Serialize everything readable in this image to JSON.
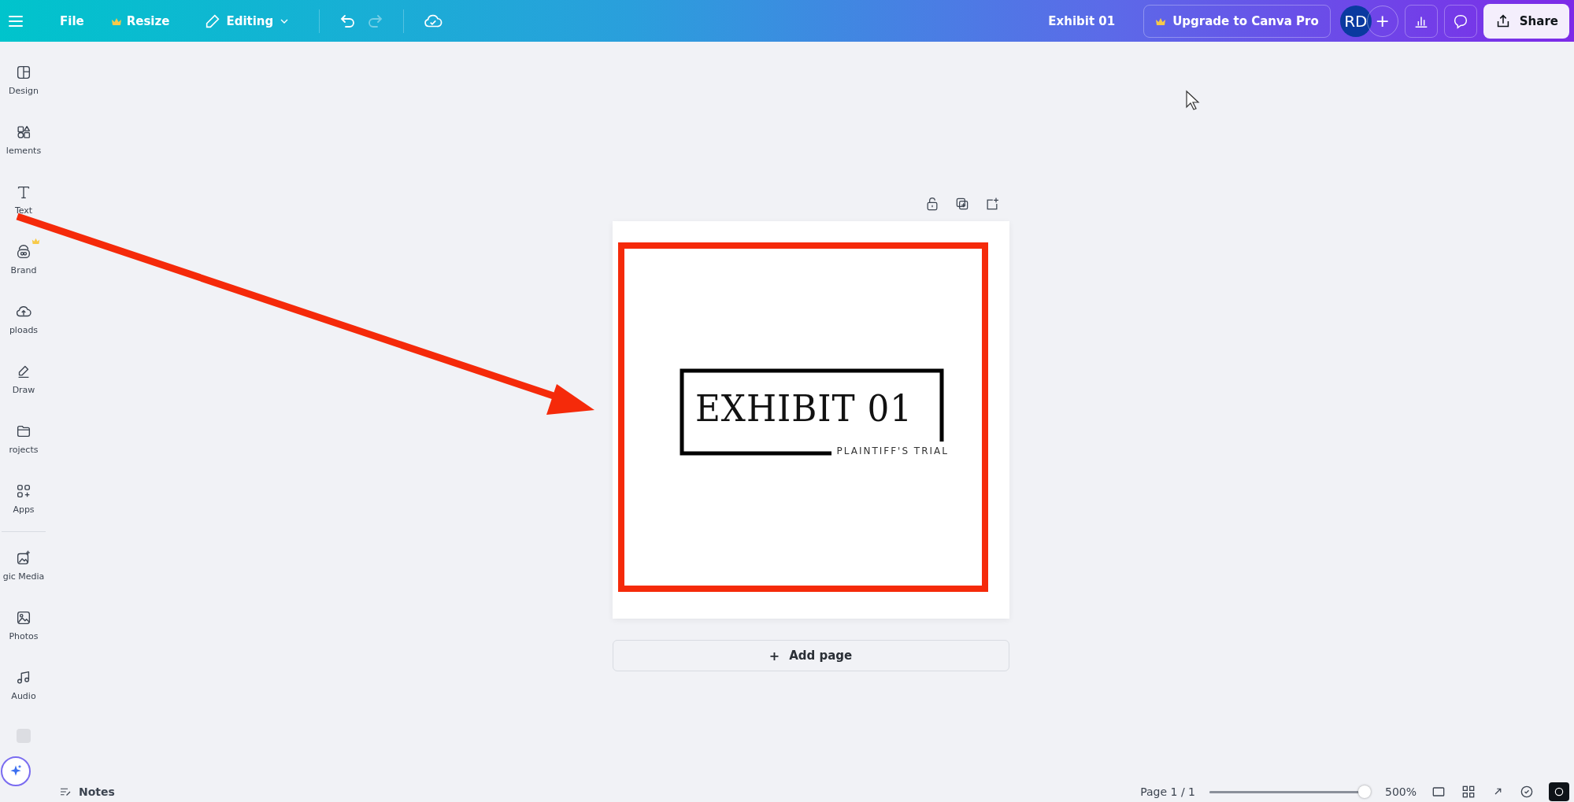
{
  "topbar": {
    "menu": true,
    "file": "File",
    "resize": {
      "label": "Resize",
      "pro": true
    },
    "mode": {
      "label": "Editing",
      "expanded": false
    },
    "undo": {
      "disabled": false
    },
    "redo": {
      "disabled": true
    },
    "doc_title": "Exhibit 01",
    "upgrade": {
      "label": "Upgrade to Canva Pro",
      "pro": true
    },
    "avatar": "RD",
    "add": "+",
    "share": "Share"
  },
  "sidebar": {
    "items": [
      {
        "label": "Design",
        "pro": false
      },
      {
        "label": "lements",
        "pro": false
      },
      {
        "label": "Text",
        "pro": false
      },
      {
        "label": "Brand",
        "pro": true
      },
      {
        "label": "ploads",
        "pro": false
      },
      {
        "label": "Draw",
        "pro": false
      },
      {
        "label": "rojects",
        "pro": false
      },
      {
        "label": "Apps",
        "pro": false
      },
      {
        "label": "gic Media",
        "pro": false
      },
      {
        "label": "Photos",
        "pro": false
      },
      {
        "label": "Audio",
        "pro": false
      }
    ]
  },
  "page": {
    "title": "EXHIBIT 01",
    "subtitle": "PLAINTIFF'S TRIAL",
    "add_page": "Add page",
    "add_icon": "+"
  },
  "bottom_bar": {
    "notes": "Notes",
    "page_count": "Page 1 / 1",
    "zoom": {
      "level": 0.96,
      "reading": "500%"
    }
  }
}
